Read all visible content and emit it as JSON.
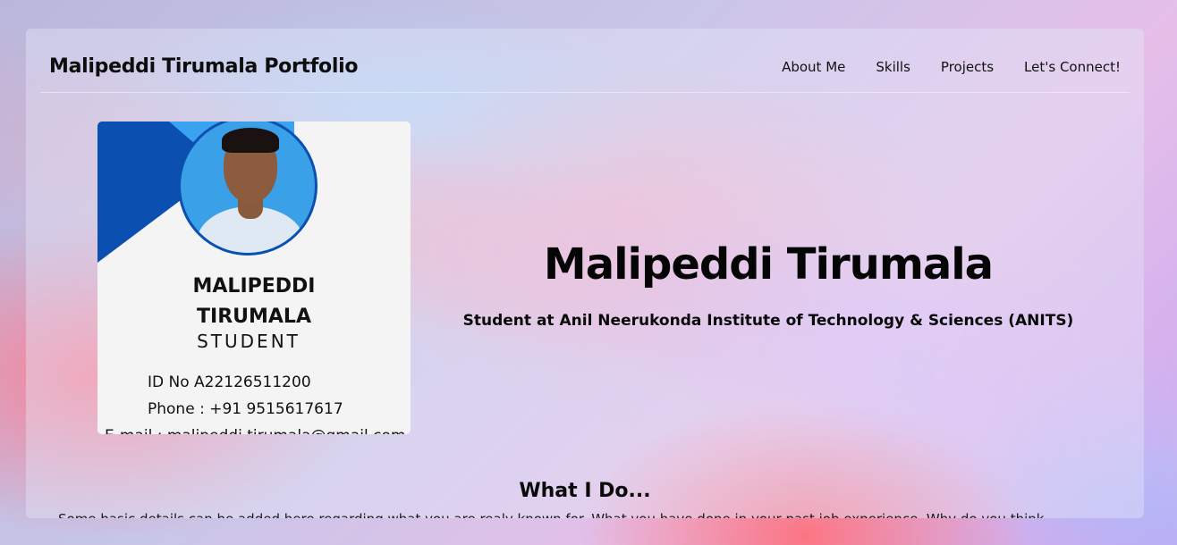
{
  "navbar": {
    "brand": "Malipeddi Tirumala Portfolio",
    "links": [
      "About Me",
      "Skills",
      "Projects",
      "Let's Connect!"
    ]
  },
  "id_card": {
    "name": "MALIPEDDI TIRUMALA",
    "role": "STUDENT",
    "id_line": "ID No   A22126511200",
    "phone_line": "Phone   : +91 9515617617",
    "email_line": "E-mail : malipeddi.tirumala@gmail.com"
  },
  "hero": {
    "title": "Malipeddi Tirumala",
    "subtitle": "Student at Anil Neerukonda Institute of Technology & Sciences (ANITS)"
  },
  "what_i_do": {
    "title": "What I Do...",
    "text": "Some basic details can be added here regarding what you are realy known for. What you have done in your past job experience. Why do you think"
  },
  "colors": {
    "card_blue_dark": "#0b4fb0",
    "card_blue_light": "#39a3f0",
    "text": "#0d0d0d"
  }
}
